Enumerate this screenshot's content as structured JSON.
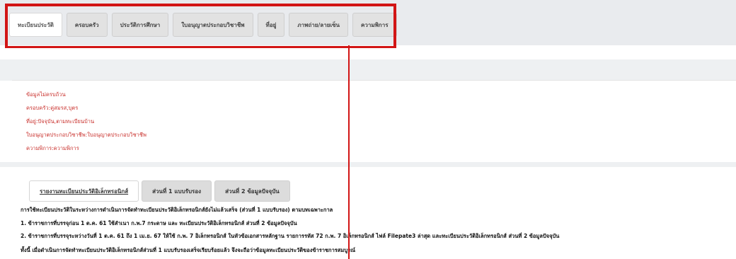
{
  "tabs": [
    {
      "label": "ทะเบียนประวัติ",
      "active": true
    },
    {
      "label": "ครอบครัว",
      "active": false
    },
    {
      "label": "ประวัติการศึกษา",
      "active": false
    },
    {
      "label": "ใบอนุญาตประกอบวิชาชีพ",
      "active": false
    },
    {
      "label": "ที่อยู่",
      "active": false
    },
    {
      "label": "ภาพถ่าย/ลายเซ็น",
      "active": false
    },
    {
      "label": "ความพิการ",
      "active": false
    }
  ],
  "errors": [
    "ข้อมูลไม่ครบถ้วน",
    "ครอบครัว:คู่สมรส,บุตร",
    "ที่อยู่:ปัจจุบัน,ตามทะเบียนบ้าน",
    "ใบอนุญาตประกอบวิชาชีพ:ใบอนุญาตประกอบวิชาชีพ",
    "ความพิการ:ความพิการ"
  ],
  "sub_tabs": [
    {
      "label": "รายงานทะเบียนประวัติอิเล็กทรอนิกส์",
      "active": true
    },
    {
      "label": "ส่วนที่ 1 แบบรับรอง",
      "active": false
    },
    {
      "label": "ส่วนที่ 2 ข้อมูลปัจจุบัน",
      "active": false
    }
  ],
  "paragraphs": [
    "การใช้ทะเบียนประวัติในระหว่างการดำเนินการจัดทำทะเบียนประวัติอิเล็กทรอนิกส์ยังไม่แล้วเสร็จ (ส่วนที่ 1 แบบรับรอง) ตามบทเฉพาะกาล",
    "1. ข้าราชการที่บรรจุก่อน 1 ต.ค. 61 ใช้สำเนา ก.พ.7 กระดาษ และ ทะเบียนประวัติอิเล็กทรอนิกส์ ส่วนที่ 2 ข้อมูลปัจจุบัน",
    "2. ข้าราชการที่บรรจุระหว่างวันที่ 1 ต.ค. 61 ถึง 1 เม.ย. 67 ให้ใช้ ก.พ. 7 อิเล็กทรอนิกส์ ในหัวข้อเอกสารหลักฐาน รายการรหัส 72 ก.พ. 7 อิเล็กทรอนิกส์ ไฟล์ Filepate3 ล่าสุด และทะเบียนประวัติอิเล็กทรอนิกส์ ส่วนที่ 2 ข้อมูลปัจจุบัน",
    "ทั้งนี้ เมื่อดำเนินการจัดทำทะเบียนประวัติอิเล็กทรอนิกส์ส่วนที่ 1 แบบรับรองเสร็จเรียบร้อยแล้ว จึงจะถือว่าข้อมูลทะเบียนประวัติของข้าราชการสมบูรณ์"
  ],
  "colors": {
    "highlight": "#d21515",
    "error_text": "#c9302c"
  }
}
